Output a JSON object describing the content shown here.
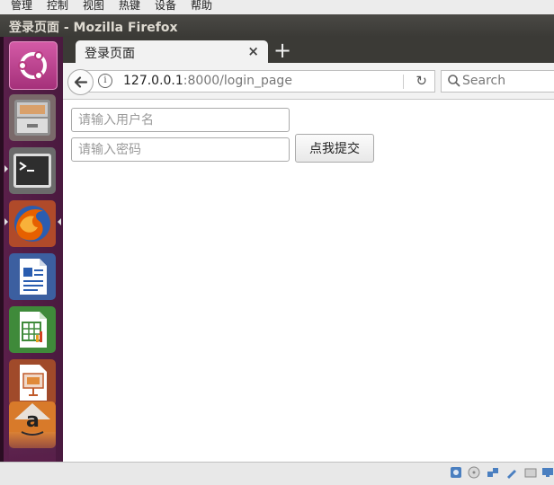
{
  "host_menubar": {
    "items": [
      "管理",
      "控制",
      "视图",
      "热键",
      "设备",
      "帮助"
    ]
  },
  "top_panel": {
    "window_title": "登录页面 - Mozilla Firefox"
  },
  "launcher": {
    "items": [
      {
        "name": "ubuntu-dash-icon"
      },
      {
        "name": "files-icon"
      },
      {
        "name": "terminal-icon"
      },
      {
        "name": "firefox-icon"
      },
      {
        "name": "libreoffice-writer-icon"
      },
      {
        "name": "libreoffice-calc-icon"
      },
      {
        "name": "libreoffice-impress-icon"
      },
      {
        "name": "amazon-icon"
      }
    ]
  },
  "browser": {
    "tab": {
      "title": "登录页面",
      "close": "×"
    },
    "new_tab": "+",
    "url": {
      "host": "127.0.0.1",
      "path": ":8000/login_page"
    },
    "search_placeholder": "Search"
  },
  "page": {
    "username_placeholder": "请输入用户名",
    "password_placeholder": "请输入密码",
    "submit_label": "点我提交"
  },
  "colors": {
    "panel": "#3b3a36",
    "launcher": "#4a1a3f",
    "dash": "#c1428f",
    "firefox_orange": "#e66000"
  }
}
